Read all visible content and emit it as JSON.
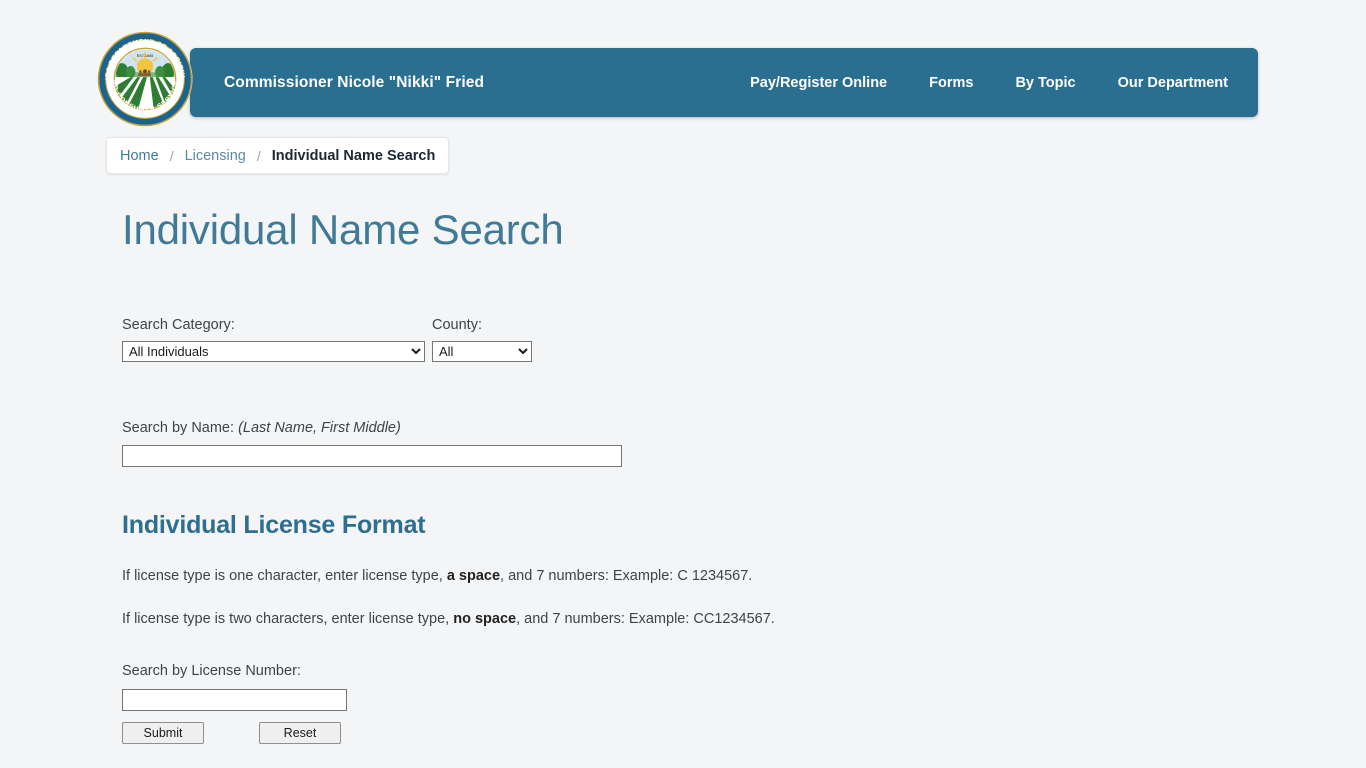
{
  "header": {
    "seal": {
      "icon": "florida-dept-agriculture-seal",
      "outer_text_top": "FLORIDA DEPARTMENT OF AGRICULTURE",
      "outer_text_bottom": "AND CONSUMER SERVICES",
      "est_label": "EST.1868"
    },
    "commissioner": "Commissioner Nicole \"Nikki\" Fried",
    "nav_items": [
      {
        "label": "Pay/Register Online"
      },
      {
        "label": "Forms"
      },
      {
        "label": "By Topic"
      },
      {
        "label": "Our Department"
      }
    ]
  },
  "breadcrumb": {
    "items": [
      {
        "label": "Home",
        "current": false
      },
      {
        "label": "Licensing",
        "current": false
      },
      {
        "label": "Individual Name Search",
        "current": true
      }
    ],
    "separator": "/"
  },
  "main": {
    "page_title": "Individual Name Search",
    "search_category": {
      "label": "Search Category:",
      "selected": "All Individuals"
    },
    "county": {
      "label": "County:",
      "selected": "All"
    },
    "search_by_name": {
      "label": "Search by Name:",
      "hint": "(Last Name, First Middle)",
      "value": ""
    },
    "license_format": {
      "heading": "Individual License Format",
      "line1_a": "If license type is one character, enter license type, ",
      "line1_bold": "a space",
      "line1_b": ", and 7 numbers:   Example:   C 1234567.",
      "line2_a": "If license type is two characters, enter license type, ",
      "line2_bold": "no space",
      "line2_b": ", and 7 numbers:   Example: CC1234567."
    },
    "search_by_license": {
      "label": "Search by License Number:",
      "value": ""
    },
    "buttons": {
      "submit": "Submit",
      "reset": "Reset"
    }
  },
  "colors": {
    "nav_bar": "#2a6f8f",
    "page_background": "#f4f5f6",
    "title": "#417a97",
    "heading": "#2e6e8e",
    "breadcrumb_link": "#3e7b9c"
  }
}
